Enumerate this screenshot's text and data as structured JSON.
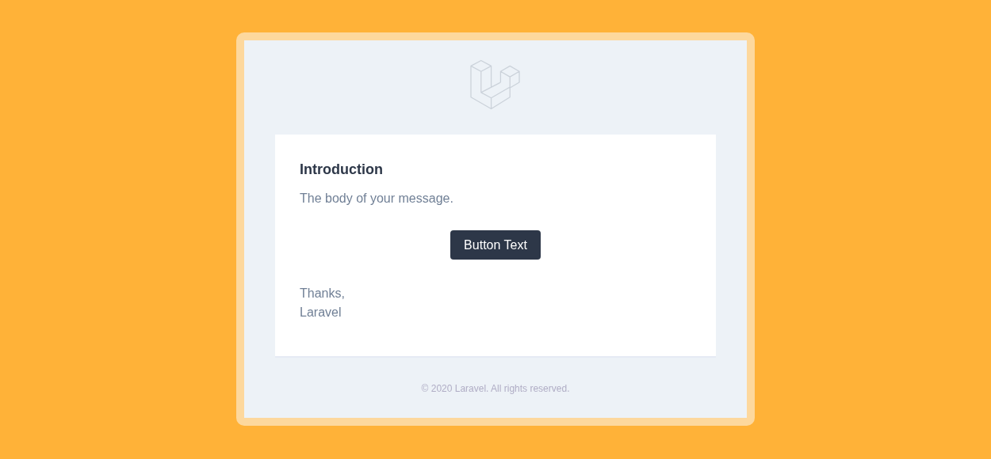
{
  "email": {
    "heading": "Introduction",
    "body": "The body of your message.",
    "button": "Button Text",
    "salutation": [
      "Thanks,",
      "Laravel"
    ]
  },
  "footer": "© 2020 Laravel. All rights reserved."
}
